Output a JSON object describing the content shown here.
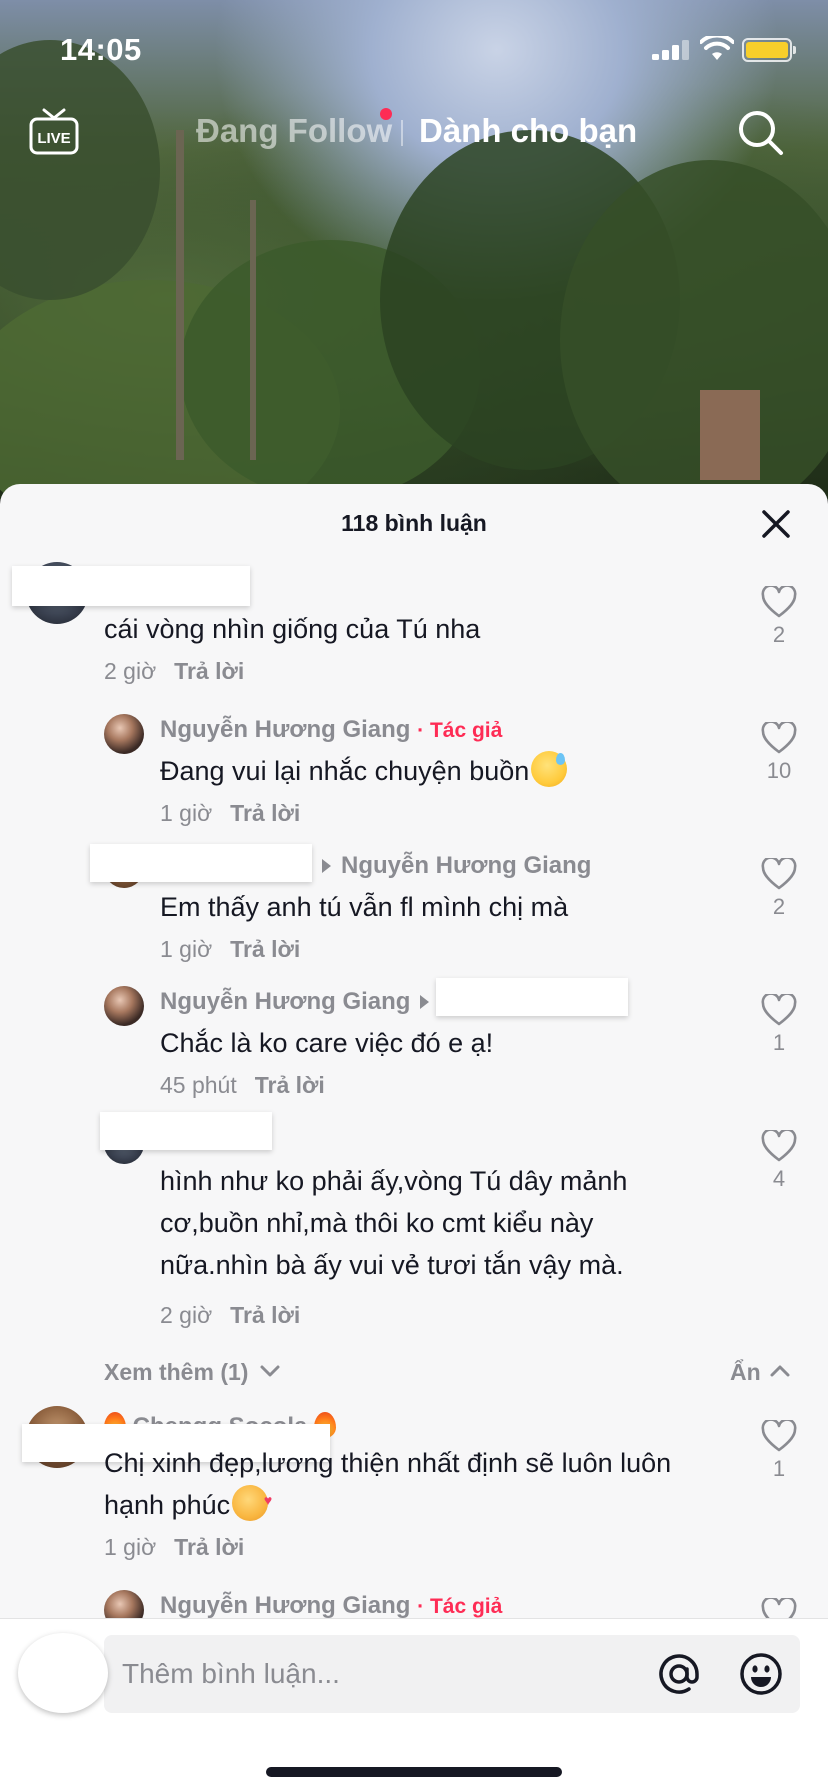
{
  "status_bar": {
    "time": "14:05"
  },
  "nav": {
    "live_label": "LIVE",
    "following": "Đang Follow",
    "for_you": "Dành cho bạn"
  },
  "comments_header": {
    "title": "118 bình luận"
  },
  "comments": [
    {
      "text": "cái vòng nhìn giống của Tú nha",
      "time": "2 giờ",
      "reply": "Trả lời",
      "likes": "2"
    },
    {
      "user": "Nguyễn Hương Giang",
      "badge": "· Tác giả",
      "text": "Đang vui lại nhắc chuyện buồn",
      "time": "1 giờ",
      "reply": "Trả lời",
      "likes": "10"
    },
    {
      "reply_to": "Nguyễn Hương Giang",
      "text": "Em thấy anh tú vẫn fl mình chị mà",
      "time": "1 giờ",
      "reply": "Trả lời",
      "likes": "2"
    },
    {
      "user": "Nguyễn Hương Giang",
      "text": "Chắc là ko care việc đó e ạ!",
      "time": "45 phút",
      "reply": "Trả lời",
      "likes": "1"
    },
    {
      "text_line1": "hình như ko phải ấy,vòng Tú dây mảnh",
      "text_line2": "cơ,buồn nhỉ,mà thôi ko cmt kiểu này",
      "text_line3": "nữa.nhìn bà ấy vui vẻ tươi tắn vậy mà.",
      "time": "2 giờ",
      "reply": "Trả lời",
      "likes": "4"
    },
    {
      "user": "Chengg Socola",
      "text_line1": "Chị xinh đẹp,lương thiện nhất định sẽ luôn luôn",
      "text_line2": "hạnh phúc",
      "time": "1 giờ",
      "reply": "Trả lời",
      "likes": "1"
    },
    {
      "user": "Nguyễn Hương Giang",
      "badge": "· Tác giả"
    }
  ],
  "thread": {
    "view_more": "Xem thêm (1)",
    "hide": "Ẩn"
  },
  "input": {
    "placeholder": "Thêm bình luận..."
  },
  "colors": {
    "accent": "#fe2c55",
    "text": "#161823",
    "muted": "#8a8b91",
    "sheet": "#f7f7f8"
  }
}
